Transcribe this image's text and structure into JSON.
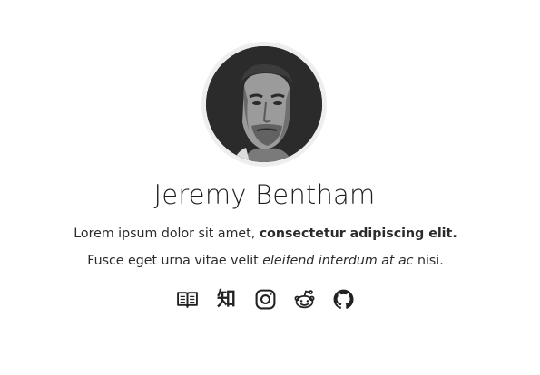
{
  "profile": {
    "name": "Jeremy Bentham",
    "bio": {
      "line1_plain": "Lorem ipsum dolor sit amet, ",
      "line1_bold": "consectetur adipiscing elit.",
      "line2_plain_start": "Fusce eget urna vitae velit ",
      "line2_italic": "eleifend interdum at ac",
      "line2_plain_end": " nisi."
    }
  },
  "social_links": [
    {
      "icon": "book-icon",
      "label": "Book"
    },
    {
      "icon": "zhihu-icon",
      "label": "知"
    },
    {
      "icon": "instagram-icon",
      "label": "Instagram"
    },
    {
      "icon": "reddit-icon",
      "label": "Reddit"
    },
    {
      "icon": "github-icon",
      "label": "GitHub"
    }
  ],
  "colors": {
    "text": "#222222",
    "avatar_ring": "#eeeeee"
  }
}
